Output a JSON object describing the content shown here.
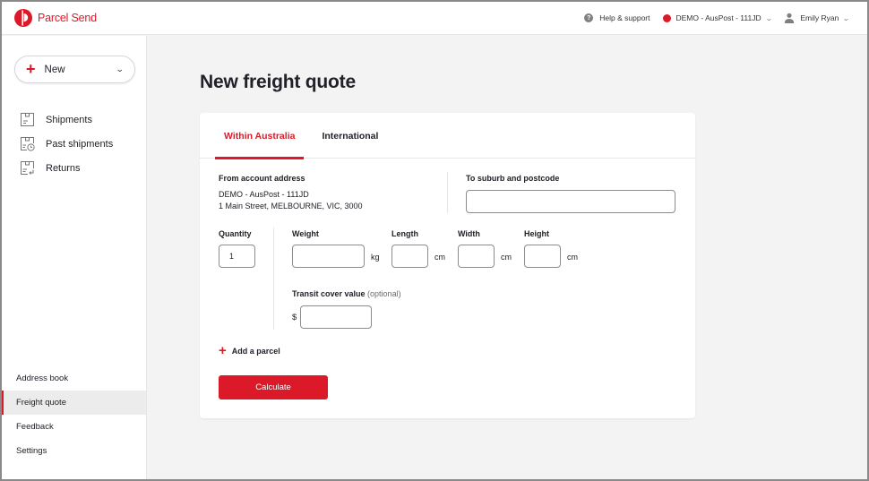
{
  "app": {
    "brand_name": "Parcel Send",
    "brand_color": "#dc1928"
  },
  "topbar": {
    "help_label": "Help & support",
    "account_label": "DEMO - AusPost - 111JD",
    "user_label": "Emily Ryan",
    "help_icon": "?"
  },
  "sidebar": {
    "new_button": {
      "label": "New",
      "plus": "+",
      "chevron": "⌄"
    },
    "top_items": [
      {
        "label": "Shipments",
        "icon": "box-icon"
      },
      {
        "label": "Past shipments",
        "icon": "box-clock-icon"
      },
      {
        "label": "Returns",
        "icon": "box-return-icon"
      }
    ],
    "bottom_items": [
      {
        "label": "Address book",
        "active": false
      },
      {
        "label": "Freight quote",
        "active": true
      },
      {
        "label": "Feedback",
        "active": false
      },
      {
        "label": "Settings",
        "active": false
      }
    ]
  },
  "main": {
    "title": "New freight quote",
    "tabs": [
      {
        "label": "Within Australia",
        "active": true
      },
      {
        "label": "International",
        "active": false
      }
    ],
    "from": {
      "label": "From account address",
      "line1": "DEMO - AusPost - 111JD",
      "line2": "1 Main Street, MELBOURNE, VIC, 3000"
    },
    "to": {
      "label": "To suburb and postcode",
      "value": "",
      "placeholder": ""
    },
    "quantity": {
      "label": "Quantity",
      "value": "1"
    },
    "weight": {
      "label": "Weight",
      "value": "",
      "unit": "kg"
    },
    "length": {
      "label": "Length",
      "value": "",
      "unit": "cm"
    },
    "width": {
      "label": "Width",
      "value": "",
      "unit": "cm"
    },
    "height": {
      "label": "Height",
      "value": "",
      "unit": "cm"
    },
    "transit_cover": {
      "label": "Transit cover value",
      "optional": " (optional)",
      "currency": "$",
      "value": ""
    },
    "add_parcel": {
      "plus": "+",
      "label": "Add a parcel"
    },
    "calculate_label": "Calculate"
  }
}
